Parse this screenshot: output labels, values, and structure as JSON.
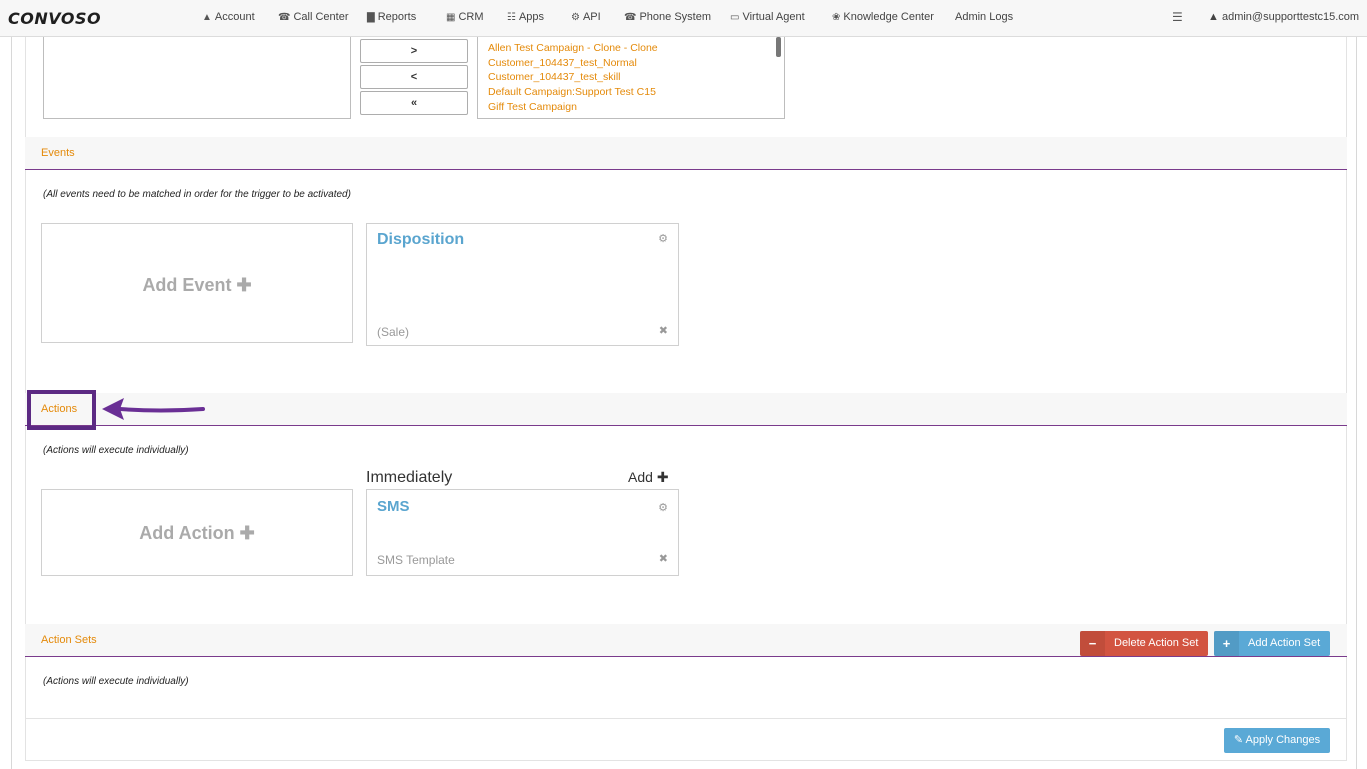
{
  "nav": {
    "logo": "CONVOSO",
    "items": [
      {
        "label": "Account",
        "icon": "user-icon",
        "glyph": "▲"
      },
      {
        "label": "Call Center",
        "icon": "phone-icon",
        "glyph": "☎"
      },
      {
        "label": "Reports",
        "icon": "bar-chart-icon",
        "glyph": "▇"
      },
      {
        "label": "CRM",
        "icon": "table-icon",
        "glyph": "▦"
      },
      {
        "label": "Apps",
        "icon": "grid-icon",
        "glyph": "☷"
      },
      {
        "label": "API",
        "icon": "gear-icon",
        "glyph": "⚙"
      },
      {
        "label": "Phone System",
        "icon": "phone-icon",
        "glyph": "☎"
      },
      {
        "label": "Virtual Agent",
        "icon": "monitor-icon",
        "glyph": "▭"
      },
      {
        "label": "Knowledge Center",
        "icon": "lightbulb-icon",
        "glyph": "❀"
      },
      {
        "label": "Admin Logs",
        "icon": "",
        "glyph": ""
      }
    ],
    "db_icon": "database-icon",
    "user": "admin@supporttestc15.com"
  },
  "campaigns": {
    "move_buttons": [
      ">",
      "<",
      "«"
    ],
    "assigned": [
      "Allen Test Campaign - Clone - Clone",
      "Customer_104437_test_Normal",
      "Customer_104437_test_skill",
      "Default Campaign:Support Test C15",
      "Giff Test Campaign"
    ]
  },
  "events": {
    "header": "Events",
    "note": "(All events need to be matched in order for the trigger to be activated)",
    "add_label": "Add Event",
    "card": {
      "title": "Disposition",
      "subtitle": "(Sale)"
    }
  },
  "actions": {
    "header": "Actions",
    "note": "(Actions will execute individually)",
    "add_label": "Add Action",
    "timing": "Immediately",
    "add_link": "Add",
    "card": {
      "title": "SMS",
      "subtitle": "SMS Template"
    }
  },
  "action_sets": {
    "header": "Action Sets",
    "note": "(Actions will execute individually)",
    "delete_label": "Delete Action Set",
    "add_label": "Add Action Set"
  },
  "apply_label": "Apply Changes",
  "colors": {
    "accent_orange": "#e48a0a",
    "accent_blue": "#5aa5cf",
    "danger": "#d25441",
    "highlight_purple": "#5c2a83"
  }
}
